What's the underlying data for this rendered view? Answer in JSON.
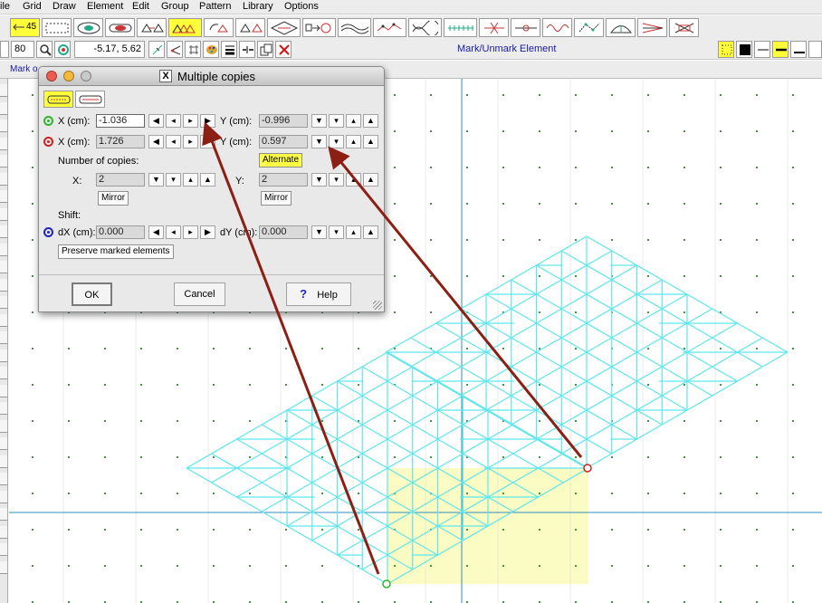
{
  "menubar": {
    "items": [
      {
        "label": "File",
        "shown": "ile"
      },
      {
        "label": "Grid"
      },
      {
        "label": "Draw"
      },
      {
        "label": "Element"
      },
      {
        "label": "Edit"
      },
      {
        "label": "Group"
      },
      {
        "label": "Pattern"
      },
      {
        "label": "Library"
      },
      {
        "label": "Options"
      }
    ]
  },
  "toolbar": {
    "angle_label": "45",
    "zoom_value": "80",
    "coords_value": "-5.17,  5.62",
    "mode_label": "Mark/Unmark Element"
  },
  "statusbar": {
    "text": "Mark o"
  },
  "dialog": {
    "title": "Multiple copies",
    "point1": {
      "x_label": "X (cm):",
      "x_value": "-1.036",
      "y_label": "Y (cm):",
      "y_value": "-0.996",
      "color": "#2fb52f"
    },
    "point2": {
      "x_label": "X (cm):",
      "x_value": "1.726",
      "y_label": "Y (cm):",
      "y_value": "0.597",
      "color": "#cc2222"
    },
    "alternate_label": "Alternate",
    "copies_label": "Number of copies:",
    "copies_x_label": "X:",
    "copies_x_value": "2",
    "copies_y_label": "Y:",
    "copies_y_value": "2",
    "mirror_x_label": "Mirror",
    "mirror_y_label": "Mirror",
    "shift_label": "Shift:",
    "shift": {
      "dx_label": "dX (cm):",
      "dx_value": "0.000",
      "dy_label": "dY (cm):",
      "dy_value": "0.000",
      "color": "#2222bb"
    },
    "preserve_label": "Preserve marked elements",
    "ok_label": "OK",
    "cancel_label": "Cancel",
    "help_label": "Help",
    "help_glyph": "?"
  },
  "colors": {
    "pattern": "#5fe6ec",
    "highlight": "#fbfbc4",
    "grid_line": "#2f8fb8",
    "grid_dot": "#2a8f2a",
    "arrow": "#8b1f14",
    "toolbar_selected": "#ffff3a"
  }
}
